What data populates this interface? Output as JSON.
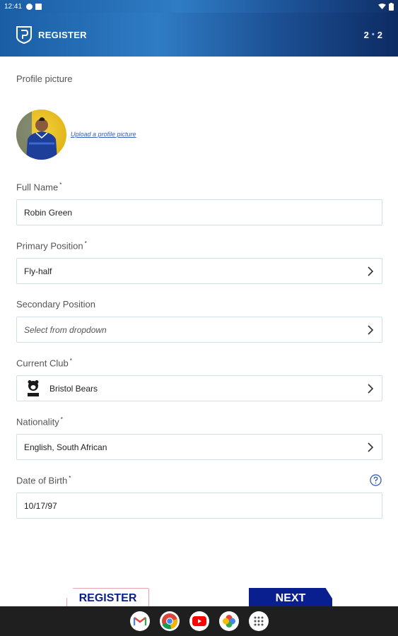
{
  "status_bar": {
    "time": "12:41"
  },
  "header": {
    "title": "REGISTER",
    "step_current": "2",
    "step_sep": "•",
    "step_total": "2"
  },
  "profile": {
    "label": "Profile picture",
    "upload_link": "Upload a profile picture"
  },
  "form": {
    "full_name": {
      "label": "Full Name",
      "required": "*",
      "value": "Robin Green"
    },
    "primary_position": {
      "label": "Primary Position",
      "required": "*",
      "value": "Fly-half"
    },
    "secondary_position": {
      "label": "Secondary Position",
      "placeholder": "Select from dropdown"
    },
    "current_club": {
      "label": "Current Club",
      "required": "*",
      "value": "Bristol Bears"
    },
    "nationality": {
      "label": "Nationality",
      "required": "*",
      "value": "English, South African"
    },
    "date_of_birth": {
      "label": "Date of Birth",
      "required": "*",
      "value": "10/17/97"
    }
  },
  "buttons": {
    "register": "REGISTER",
    "next": "NEXT"
  },
  "colors": {
    "accent": "#0a1f8f",
    "header_start": "#1a5ea5",
    "header_end": "#0d2b63",
    "field_border": "#cfe0ea"
  },
  "nav_apps": [
    "gmail-icon",
    "chrome-icon",
    "youtube-icon",
    "photos-icon",
    "app-drawer-icon"
  ]
}
